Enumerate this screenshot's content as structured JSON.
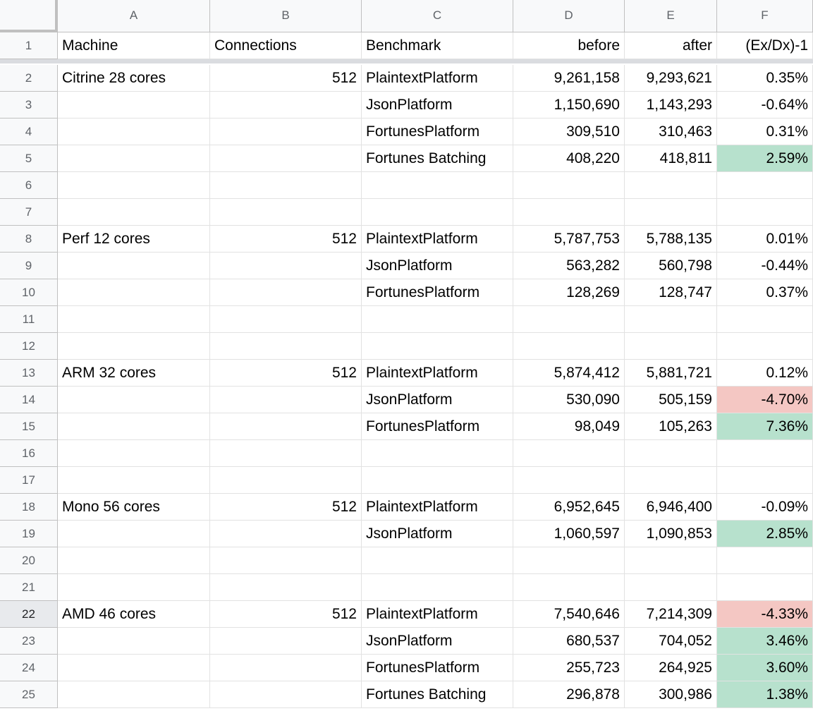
{
  "columns": [
    "A",
    "B",
    "C",
    "D",
    "E",
    "F"
  ],
  "colors": {
    "positive_highlight": "#b7e1cd",
    "negative_highlight": "#f4c7c3",
    "header_bg": "#f8f9fa",
    "grid": "#e2e2e2"
  },
  "rows": [
    {
      "n": "1",
      "a": "Machine",
      "b": "Connections",
      "c": "Benchmark",
      "d": "before",
      "e": "after",
      "f": "(Ex/Dx)-1",
      "hl": ""
    },
    {
      "n": "2",
      "a": "Citrine 28 cores",
      "b": "512",
      "c": "PlaintextPlatform",
      "d": "9,261,158",
      "e": "9,293,621",
      "f": "0.35%",
      "hl": ""
    },
    {
      "n": "3",
      "a": "",
      "b": "",
      "c": "JsonPlatform",
      "d": "1,150,690",
      "e": "1,143,293",
      "f": "-0.64%",
      "hl": ""
    },
    {
      "n": "4",
      "a": "",
      "b": "",
      "c": "FortunesPlatform",
      "d": "309,510",
      "e": "310,463",
      "f": "0.31%",
      "hl": ""
    },
    {
      "n": "5",
      "a": "",
      "b": "",
      "c": "Fortunes Batching",
      "d": "408,220",
      "e": "418,811",
      "f": "2.59%",
      "hl": "pos"
    },
    {
      "n": "6",
      "a": "",
      "b": "",
      "c": "",
      "d": "",
      "e": "",
      "f": "",
      "hl": ""
    },
    {
      "n": "7",
      "a": "",
      "b": "",
      "c": "",
      "d": "",
      "e": "",
      "f": "",
      "hl": ""
    },
    {
      "n": "8",
      "a": "Perf 12 cores",
      "b": "512",
      "c": "PlaintextPlatform",
      "d": "5,787,753",
      "e": "5,788,135",
      "f": "0.01%",
      "hl": ""
    },
    {
      "n": "9",
      "a": "",
      "b": "",
      "c": "JsonPlatform",
      "d": "563,282",
      "e": "560,798",
      "f": "-0.44%",
      "hl": ""
    },
    {
      "n": "10",
      "a": "",
      "b": "",
      "c": "FortunesPlatform",
      "d": "128,269",
      "e": "128,747",
      "f": "0.37%",
      "hl": ""
    },
    {
      "n": "11",
      "a": "",
      "b": "",
      "c": "",
      "d": "",
      "e": "",
      "f": "",
      "hl": ""
    },
    {
      "n": "12",
      "a": "",
      "b": "",
      "c": "",
      "d": "",
      "e": "",
      "f": "",
      "hl": ""
    },
    {
      "n": "13",
      "a": "ARM 32 cores",
      "b": "512",
      "c": "PlaintextPlatform",
      "d": "5,874,412",
      "e": "5,881,721",
      "f": "0.12%",
      "hl": ""
    },
    {
      "n": "14",
      "a": "",
      "b": "",
      "c": "JsonPlatform",
      "d": "530,090",
      "e": "505,159",
      "f": "-4.70%",
      "hl": "neg"
    },
    {
      "n": "15",
      "a": "",
      "b": "",
      "c": "FortunesPlatform",
      "d": "98,049",
      "e": "105,263",
      "f": "7.36%",
      "hl": "pos"
    },
    {
      "n": "16",
      "a": "",
      "b": "",
      "c": "",
      "d": "",
      "e": "",
      "f": "",
      "hl": ""
    },
    {
      "n": "17",
      "a": "",
      "b": "",
      "c": "",
      "d": "",
      "e": "",
      "f": "",
      "hl": ""
    },
    {
      "n": "18",
      "a": "Mono 56 cores",
      "b": "512",
      "c": "PlaintextPlatform",
      "d": "6,952,645",
      "e": "6,946,400",
      "f": "-0.09%",
      "hl": ""
    },
    {
      "n": "19",
      "a": "",
      "b": "",
      "c": "JsonPlatform",
      "d": "1,060,597",
      "e": "1,090,853",
      "f": "2.85%",
      "hl": "pos"
    },
    {
      "n": "20",
      "a": "",
      "b": "",
      "c": "",
      "d": "",
      "e": "",
      "f": "",
      "hl": ""
    },
    {
      "n": "21",
      "a": "",
      "b": "",
      "c": "",
      "d": "",
      "e": "",
      "f": "",
      "hl": ""
    },
    {
      "n": "22",
      "a": "AMD 46 cores",
      "b": "512",
      "c": "PlaintextPlatform",
      "d": "7,540,646",
      "e": "7,214,309",
      "f": "-4.33%",
      "hl": "neg"
    },
    {
      "n": "23",
      "a": "",
      "b": "",
      "c": "JsonPlatform",
      "d": "680,537",
      "e": "704,052",
      "f": "3.46%",
      "hl": "pos"
    },
    {
      "n": "24",
      "a": "",
      "b": "",
      "c": "FortunesPlatform",
      "d": "255,723",
      "e": "264,925",
      "f": "3.60%",
      "hl": "pos"
    },
    {
      "n": "25",
      "a": "",
      "b": "",
      "c": "Fortunes Batching",
      "d": "296,878",
      "e": "300,986",
      "f": "1.38%",
      "hl": "pos"
    }
  ],
  "selected_row": "22"
}
